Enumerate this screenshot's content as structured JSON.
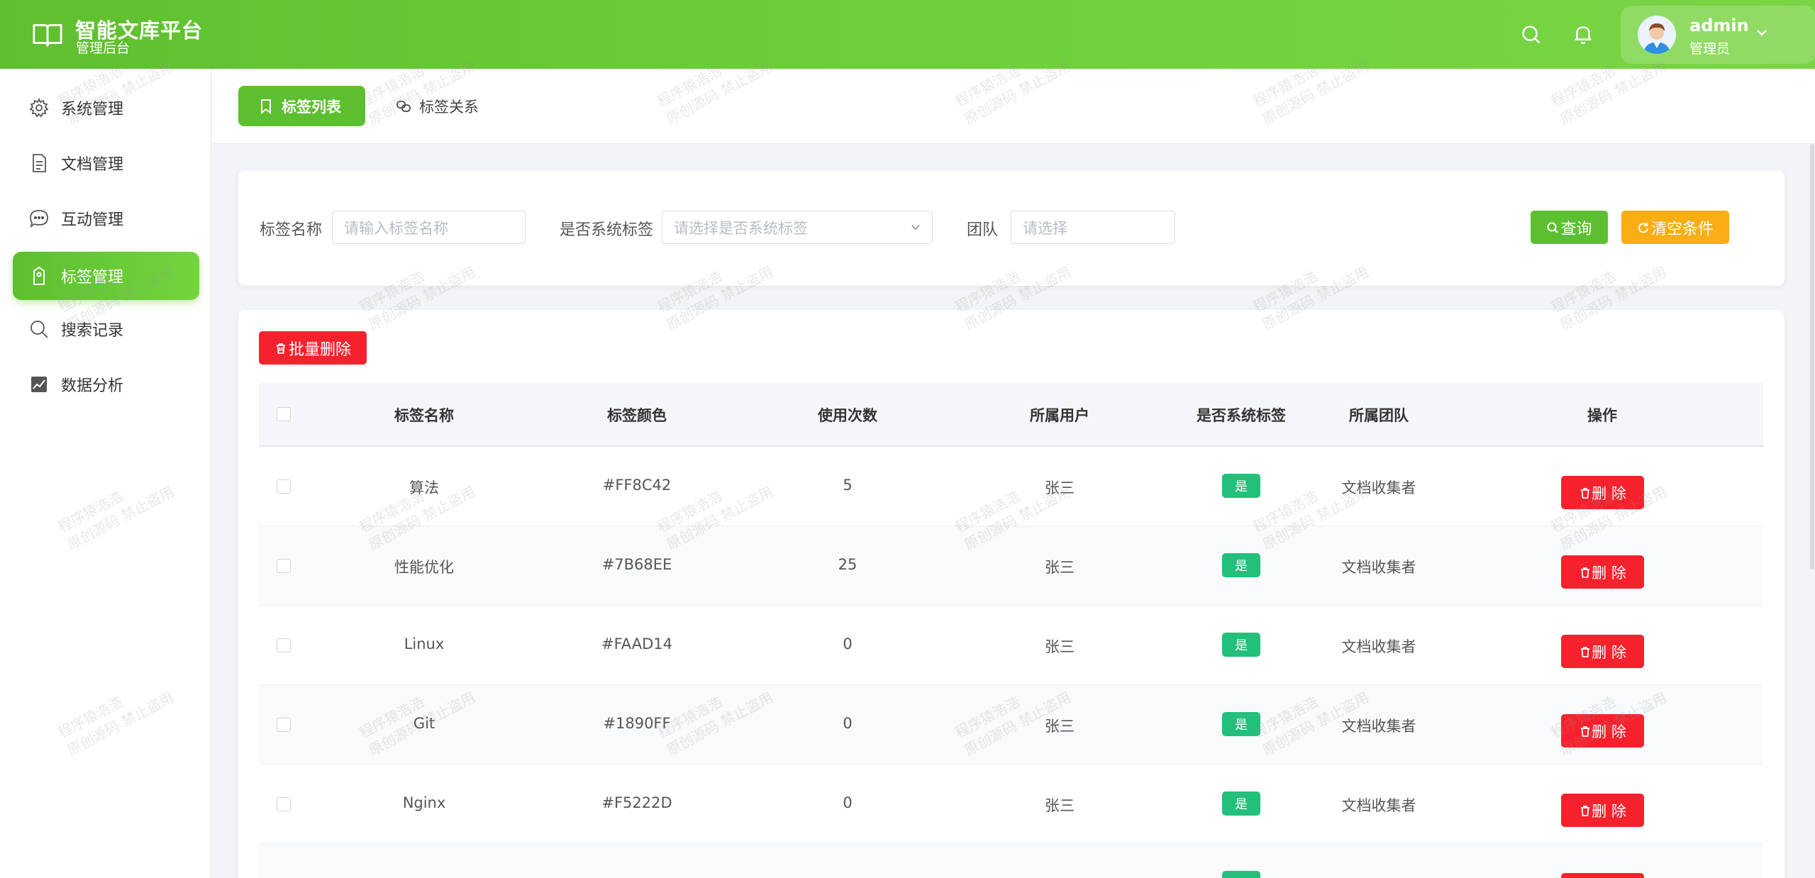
{
  "header": {
    "title": "智能文库平台",
    "subtitle": "管理后台",
    "user": {
      "name": "admin",
      "role": "管理员"
    }
  },
  "sidebar": {
    "items": [
      {
        "label": "系统管理",
        "icon": "gear-icon"
      },
      {
        "label": "文档管理",
        "icon": "document-icon"
      },
      {
        "label": "互动管理",
        "icon": "chat-icon"
      },
      {
        "label": "标签管理",
        "icon": "tag-icon",
        "active": true
      },
      {
        "label": "搜索记录",
        "icon": "search-icon"
      },
      {
        "label": "数据分析",
        "icon": "chart-icon"
      }
    ]
  },
  "tabs": [
    {
      "label": "标签列表",
      "active": true
    },
    {
      "label": "标签关系",
      "active": false
    }
  ],
  "filter": {
    "name_label": "标签名称",
    "name_placeholder": "请输入标签名称",
    "system_label": "是否系统标签",
    "system_placeholder": "请选择是否系统标签",
    "team_label": "团队",
    "team_placeholder": "请选择",
    "query_label": "查询",
    "clear_label": "清空条件"
  },
  "table": {
    "batch_delete_label": "批量删除",
    "columns": [
      "标签名称",
      "标签颜色",
      "使用次数",
      "所属用户",
      "是否系统标签",
      "所属团队",
      "操作"
    ],
    "delete_label": "删 除",
    "rows": [
      {
        "name": "算法",
        "color": "#FF8C42",
        "count": "5",
        "user": "张三",
        "system": "是",
        "team": "文档收集者"
      },
      {
        "name": "性能优化",
        "color": "#7B68EE",
        "count": "25",
        "user": "张三",
        "system": "是",
        "team": "文档收集者"
      },
      {
        "name": "Linux",
        "color": "#FAAD14",
        "count": "0",
        "user": "张三",
        "system": "是",
        "team": "文档收集者"
      },
      {
        "name": "Git",
        "color": "#1890FF",
        "count": "0",
        "user": "张三",
        "system": "是",
        "team": "文档收集者"
      },
      {
        "name": "Nginx",
        "color": "#F5222D",
        "count": "0",
        "user": "张三",
        "system": "是",
        "team": "文档收集者"
      }
    ]
  },
  "watermark": {
    "line1": "程序猿浩浩",
    "line2": "原创源码 禁止盗用"
  },
  "colors": {
    "primary": "#5cbf2f",
    "warning": "#faad14",
    "danger": "#f5222d",
    "success_badge": "#22c07a"
  }
}
